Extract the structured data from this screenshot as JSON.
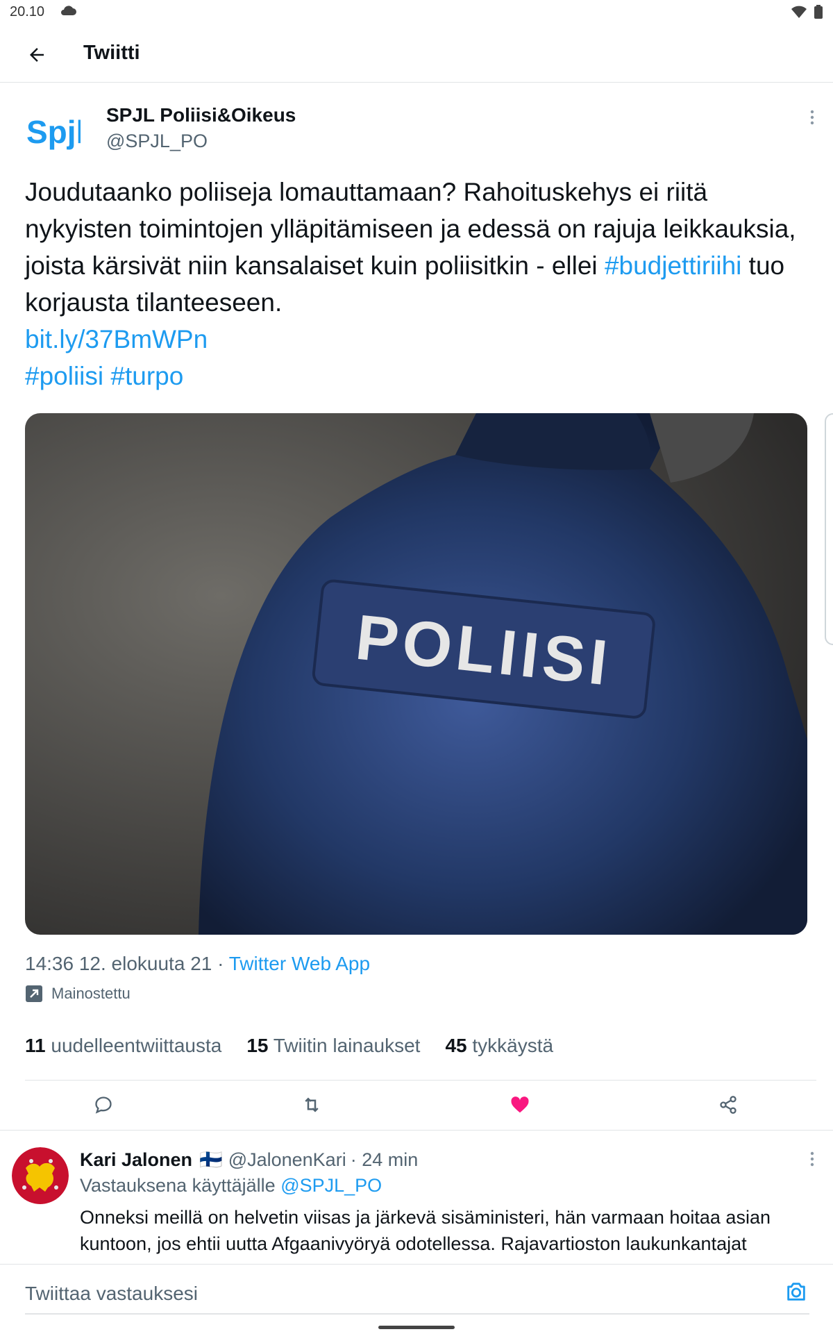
{
  "status_bar": {
    "time": "20.10"
  },
  "app_bar": {
    "title": "Twiitti"
  },
  "tweet": {
    "author_name": "SPJL Poliisi&Oikeus",
    "author_handle": "@SPJL_PO",
    "avatar_logo_text": "Spjl",
    "text_1": "Joudutaanko poliiseja lomauttamaan? Rahoituskehys ei riitä nykyisten toimintojen ylläpitämiseen ja edessä on rajuja leikkauksia, joista kärsivät niin kansalaiset kuin poliisitkin - ellei",
    "hashtag_1": "#budjettiriihi",
    "text_2": "tuo korjausta tilanteeseen.",
    "link": "bit.ly/37BmWPn",
    "hashtag_2": "#poliisi",
    "hashtag_3": "#turpo",
    "image_text": "POLIISI",
    "timestamp": "14:36 12. elokuuta 21 · ",
    "source_app": "Twitter Web App",
    "promoted_label": "Mainostettu",
    "retweets_count": "11",
    "retweets_label": "uudelleentwiittausta",
    "quotes_count": "15",
    "quotes_label": "Twiitin lainaukset",
    "likes_count": "45",
    "likes_label": "tykkäystä",
    "liked": true,
    "like_color": "#f91880"
  },
  "reply": {
    "name": "Kari Jalonen",
    "flag": "🇫🇮",
    "handle": "@JalonenKari",
    "time": "· 24 min",
    "replying_to_label": "Vastauksena käyttäjälle",
    "replying_to_handle": "@SPJL_PO",
    "text": "Onneksi meillä on helvetin viisas ja järkevä sisäministeri, hän varmaan hoitaa asian kuntoon, jos ehtii uutta Afgaanivyöryä odotellessa. Rajavartioston laukunkantajat"
  },
  "compose": {
    "placeholder": "Twiittaa vastauksesi"
  },
  "colors": {
    "accent": "#1d9bf0",
    "text": "#0f1419",
    "muted": "#536471"
  }
}
